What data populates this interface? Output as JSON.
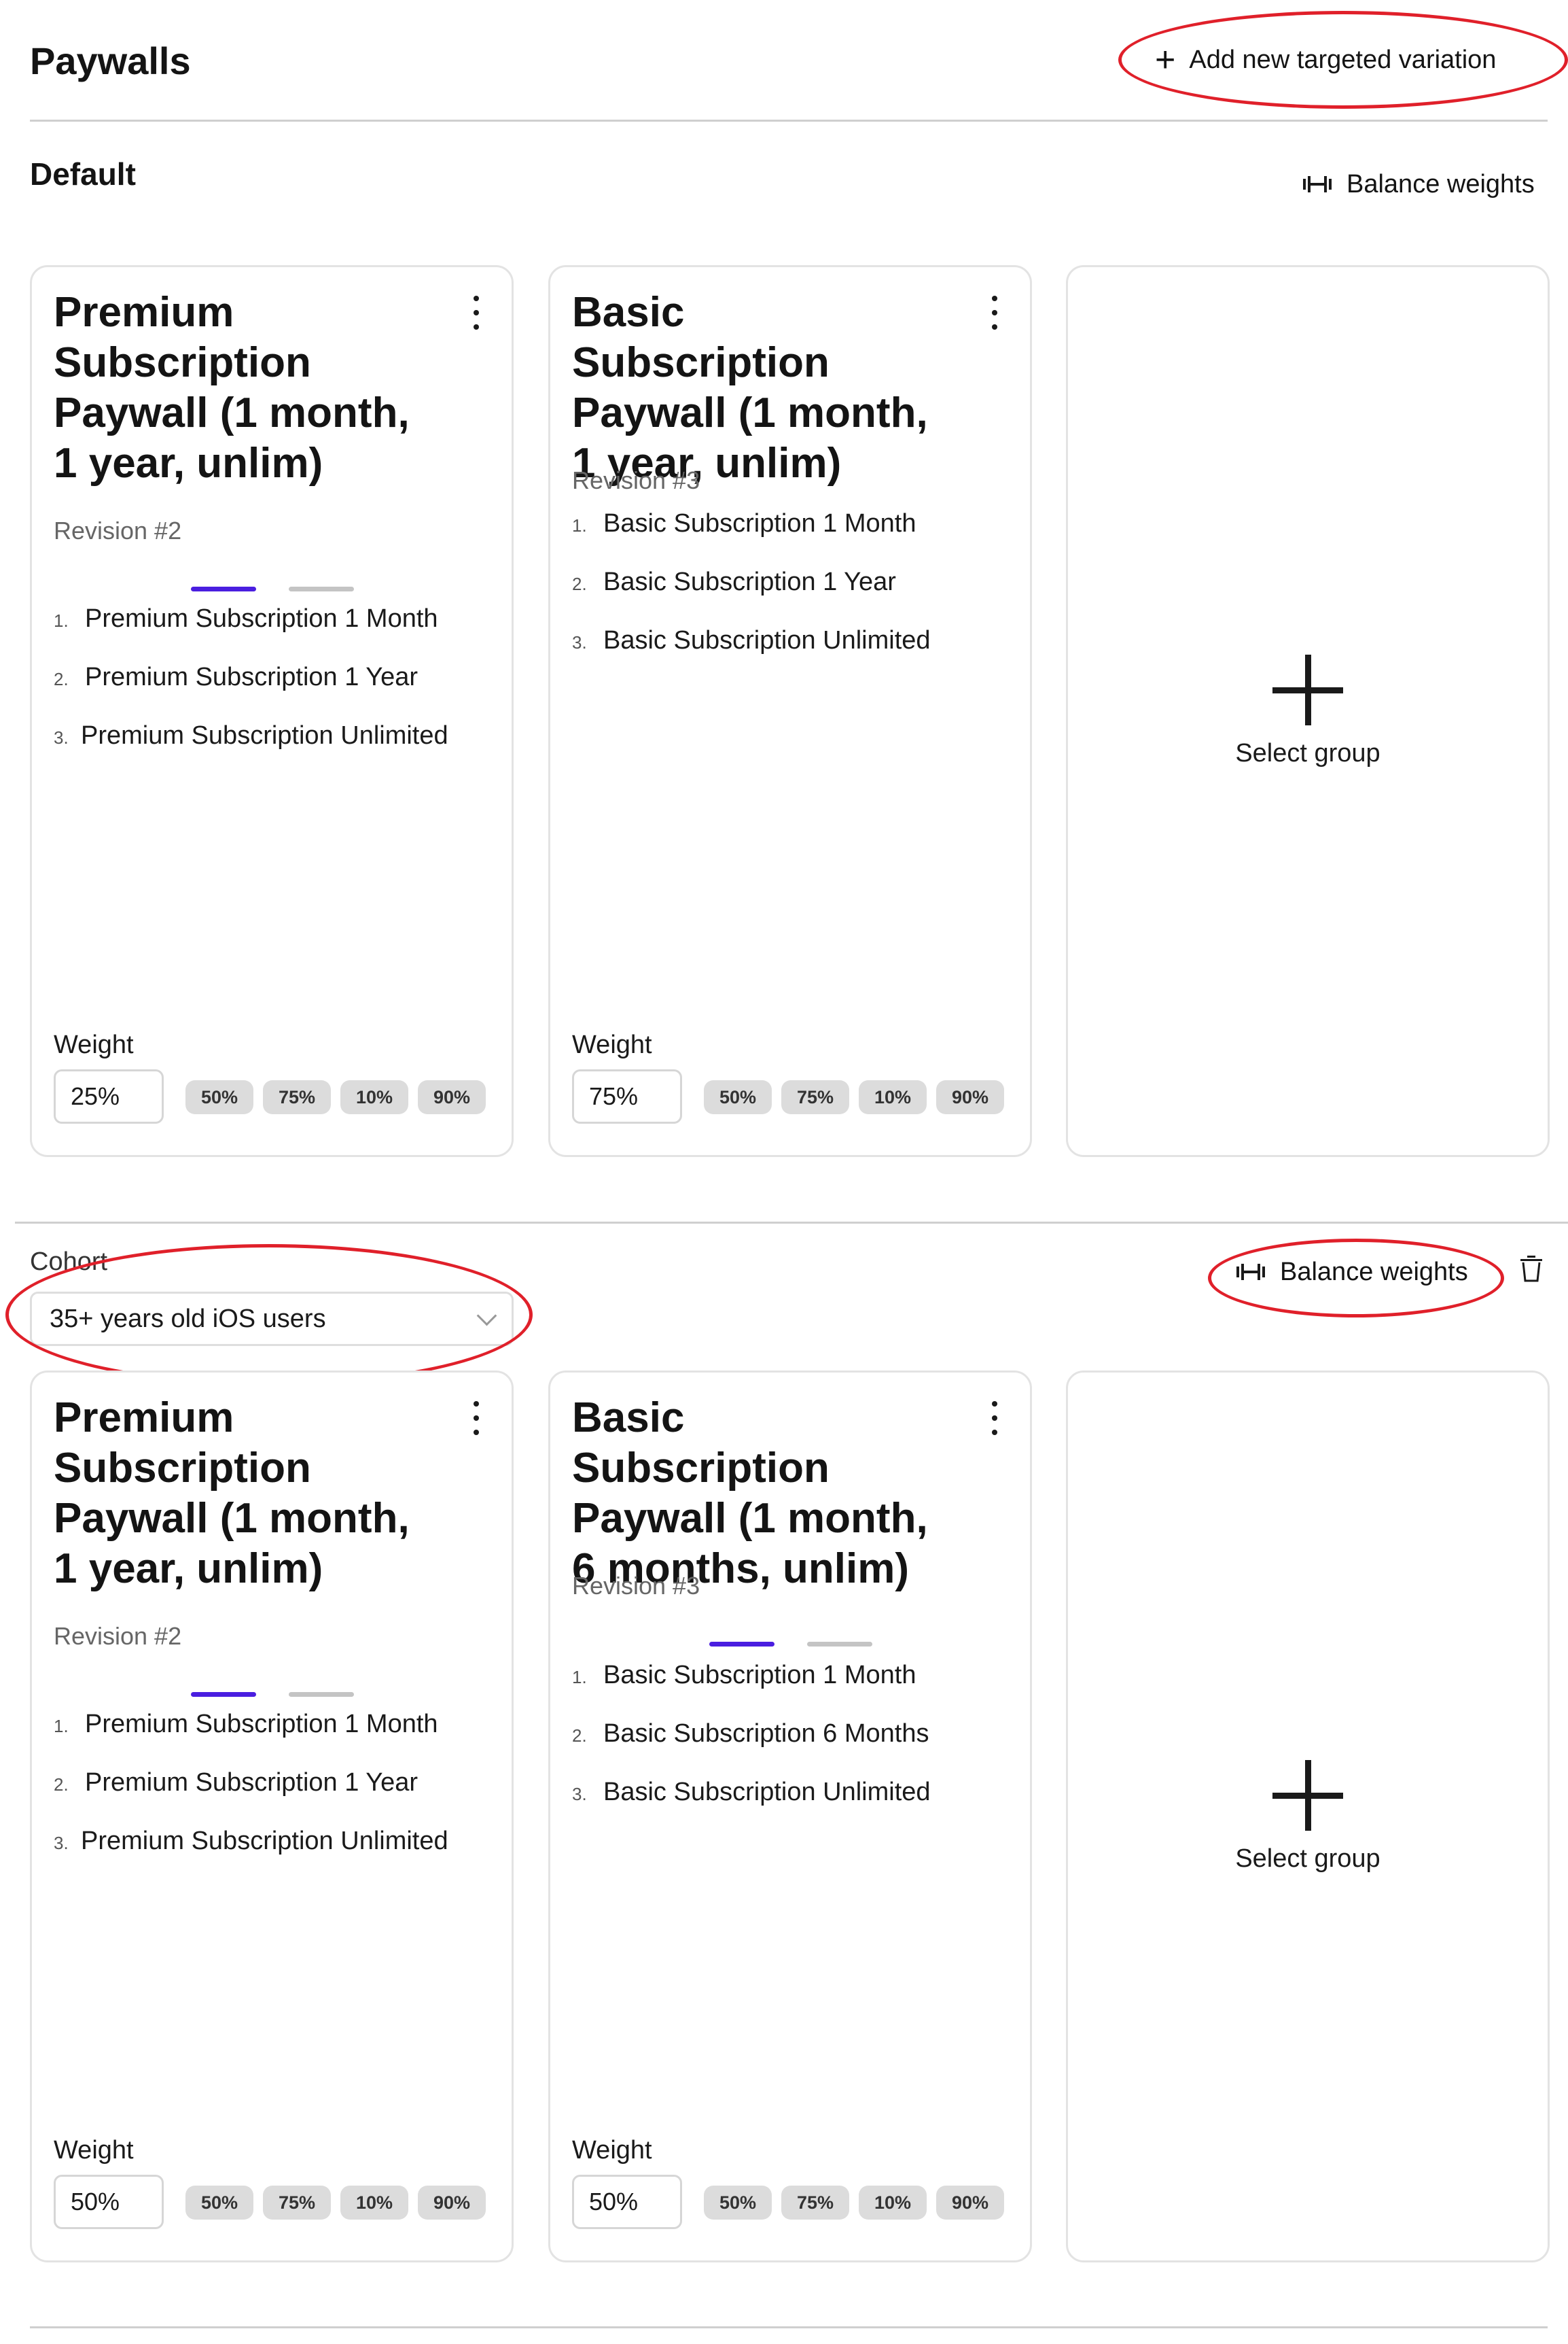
{
  "header": {
    "title": "Paywalls",
    "add_variation_label": "Add new targeted variation"
  },
  "default_section": {
    "title": "Default",
    "balance_label": "Balance weights",
    "cards": [
      {
        "title": "Premium Subscription Paywall (1 month, 1 year, unlim)",
        "revision": "Revision #2",
        "pager_active": 1,
        "products": [
          {
            "num": "1.",
            "name": "Premium Subscription 1 Month"
          },
          {
            "num": "2.",
            "name": "Premium Subscription 1 Year"
          },
          {
            "num": "3.",
            "name": "Premium Subscription Unlimited"
          }
        ],
        "weight_label": "Weight",
        "weight_value": "25%",
        "chips": [
          "50%",
          "75%",
          "10%",
          "90%"
        ]
      },
      {
        "title": "Basic Subscription Paywall (1 month, 1 year, unlim)",
        "revision": "Revision #3",
        "products": [
          {
            "num": "1.",
            "name": "Basic Subscription 1 Month"
          },
          {
            "num": "2.",
            "name": "Basic Subscription 1 Year"
          },
          {
            "num": "3.",
            "name": "Basic Subscription Unlimited"
          }
        ],
        "weight_label": "Weight",
        "weight_value": "75%",
        "chips": [
          "50%",
          "75%",
          "10%",
          "90%"
        ]
      }
    ],
    "select_group_label": "Select group"
  },
  "cohort_section": {
    "cohort_label": "Cohort",
    "cohort_value": "35+ years old iOS users",
    "balance_label": "Balance weights",
    "cards": [
      {
        "title": "Premium Subscription Paywall (1 month, 1 year, unlim)",
        "revision": "Revision #2",
        "pager_active": 1,
        "products": [
          {
            "num": "1.",
            "name": "Premium Subscription 1 Month"
          },
          {
            "num": "2.",
            "name": "Premium Subscription 1 Year"
          },
          {
            "num": "3.",
            "name": "Premium Subscription Unlimited"
          }
        ],
        "weight_label": "Weight",
        "weight_value": "50%",
        "chips": [
          "50%",
          "75%",
          "10%",
          "90%"
        ]
      },
      {
        "title": "Basic Subscription Paywall (1 month, 6 months, unlim)",
        "revision": "Revision #3",
        "pager_active": 1,
        "products": [
          {
            "num": "1.",
            "name": "Basic Subscription 1 Month"
          },
          {
            "num": "2.",
            "name": "Basic Subscription 6 Months"
          },
          {
            "num": "3.",
            "name": "Basic Subscription Unlimited"
          }
        ],
        "weight_label": "Weight",
        "weight_value": "50%",
        "chips": [
          "50%",
          "75%",
          "10%",
          "90%"
        ]
      }
    ],
    "select_group_label": "Select group"
  },
  "colors": {
    "accent": "#4a1ee0",
    "annotation": "#e0202a",
    "chip_bg": "#dcdcdc",
    "divider": "#cfcfcf"
  },
  "icons": [
    "plus-icon",
    "balance-weights-icon",
    "kebab-menu-icon",
    "chevron-down-icon",
    "trash-icon"
  ]
}
